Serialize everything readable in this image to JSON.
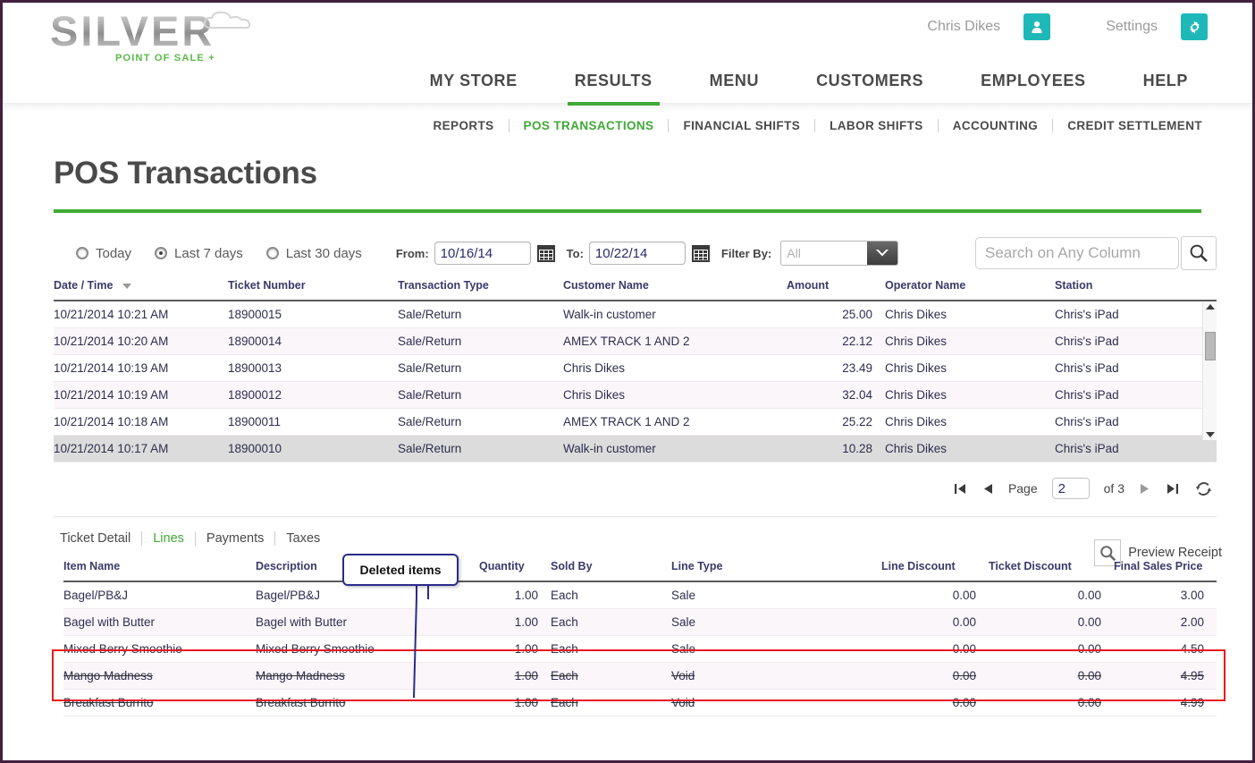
{
  "header": {
    "logo_text": "SILVER",
    "logo_sub": "POINT OF SALE +",
    "account_name": "Chris Dikes",
    "settings_label": "Settings",
    "user_icon": "user-icon",
    "gear_icon": "gear-icon",
    "accent_teal": "#1eb8b8"
  },
  "mainnav": {
    "items": [
      {
        "label": "MY STORE",
        "active": false
      },
      {
        "label": "RESULTS",
        "active": true
      },
      {
        "label": "MENU",
        "active": false
      },
      {
        "label": "CUSTOMERS",
        "active": false
      },
      {
        "label": "EMPLOYEES",
        "active": false
      },
      {
        "label": "HELP",
        "active": false
      }
    ],
    "active_color": "#3faa35"
  },
  "subnav": {
    "items": [
      {
        "label": "REPORTS",
        "active": false
      },
      {
        "label": "POS TRANSACTIONS",
        "active": true
      },
      {
        "label": "FINANCIAL SHIFTS",
        "active": false
      },
      {
        "label": "LABOR SHIFTS",
        "active": false
      },
      {
        "label": "ACCOUNTING",
        "active": false
      },
      {
        "label": "CREDIT SETTLEMENT",
        "active": false
      }
    ]
  },
  "page": {
    "title": "POS Transactions",
    "rule_color": "#3faa35"
  },
  "filters": {
    "radios": [
      {
        "label": "Today",
        "selected": false
      },
      {
        "label": "Last 7 days",
        "selected": true
      },
      {
        "label": "Last 30 days",
        "selected": false
      }
    ],
    "from_label": "From:",
    "from_value": "10/16/14",
    "to_label": "To:",
    "to_value": "10/22/14",
    "calendar_icon": "calendar-icon",
    "filter_by_label": "Filter By:",
    "filter_by_value": "All",
    "search_placeholder": "Search on Any Column",
    "search_value": "",
    "search_icon": "search-icon"
  },
  "transactions": {
    "columns": [
      "Date / Time",
      "Ticket Number",
      "Transaction Type",
      "Customer Name",
      "Amount",
      "Operator Name",
      "Station"
    ],
    "sort_column": "Date / Time",
    "sort_direction": "desc",
    "rows": [
      {
        "datetime": "10/21/2014 10:21 AM",
        "ticket": "18900015",
        "type": "Sale/Return",
        "customer": "Walk-in customer",
        "amount": "25.00",
        "operator": "Chris Dikes",
        "station": "Chris's iPad",
        "selected": false
      },
      {
        "datetime": "10/21/2014 10:20 AM",
        "ticket": "18900014",
        "type": "Sale/Return",
        "customer": "AMEX TRACK 1 AND 2",
        "amount": "22.12",
        "operator": "Chris Dikes",
        "station": "Chris's iPad",
        "selected": false
      },
      {
        "datetime": "10/21/2014 10:19 AM",
        "ticket": "18900013",
        "type": "Sale/Return",
        "customer": "Chris Dikes",
        "amount": "23.49",
        "operator": "Chris Dikes",
        "station": "Chris's iPad",
        "selected": false
      },
      {
        "datetime": "10/21/2014 10:19 AM",
        "ticket": "18900012",
        "type": "Sale/Return",
        "customer": "Chris Dikes",
        "amount": "32.04",
        "operator": "Chris Dikes",
        "station": "Chris's iPad",
        "selected": false
      },
      {
        "datetime": "10/21/2014 10:18 AM",
        "ticket": "18900011",
        "type": "Sale/Return",
        "customer": "AMEX TRACK 1 AND 2",
        "amount": "25.22",
        "operator": "Chris Dikes",
        "station": "Chris's iPad",
        "selected": false
      },
      {
        "datetime": "10/21/2014 10:17 AM",
        "ticket": "18900010",
        "type": "Sale/Return",
        "customer": "Walk-in customer",
        "amount": "10.28",
        "operator": "Chris Dikes",
        "station": "Chris's iPad",
        "selected": true
      }
    ]
  },
  "pager": {
    "first_icon": "first-page-icon",
    "prev_icon": "previous-page-icon",
    "page_label": "Page",
    "page_value": "2",
    "of_label": "of 3",
    "next_icon": "next-page-icon",
    "last_icon": "last-page-icon",
    "refresh_icon": "refresh-icon"
  },
  "detail": {
    "tabs": [
      {
        "label": "Ticket Detail",
        "active": false
      },
      {
        "label": "Lines",
        "active": true
      },
      {
        "label": "Payments",
        "active": false
      },
      {
        "label": "Taxes",
        "active": false
      }
    ],
    "preview_label": "Preview Receipt",
    "preview_icon": "magnifier-icon",
    "callout_label": "Deleted items",
    "callout_color": "#2b2b8c",
    "highlight_color": "#e81b17",
    "columns": [
      "Item Name",
      "Description",
      "Quantity",
      "Sold By",
      "Line Type",
      "Line Discount",
      "Ticket Discount",
      "Final Sales Price"
    ],
    "rows": [
      {
        "item": "Bagel/PB&J",
        "description": "Bagel/PB&J",
        "quantity": "1.00",
        "sold_by": "Each",
        "line_type": "Sale",
        "line_discount": "0.00",
        "ticket_discount": "0.00",
        "final_price": "3.00",
        "voided": false
      },
      {
        "item": "Bagel with Butter",
        "description": "Bagel with Butter",
        "quantity": "1.00",
        "sold_by": "Each",
        "line_type": "Sale",
        "line_discount": "0.00",
        "ticket_discount": "0.00",
        "final_price": "2.00",
        "voided": false
      },
      {
        "item": "Mixed Berry Smoothie",
        "description": "Mixed Berry Smoothie",
        "quantity": "1.00",
        "sold_by": "Each",
        "line_type": "Sale",
        "line_discount": "0.00",
        "ticket_discount": "0.00",
        "final_price": "4.50",
        "voided": false
      },
      {
        "item": "Mango Madness",
        "description": "Mango Madness",
        "quantity": "1.00",
        "sold_by": "Each",
        "line_type": "Void",
        "line_discount": "0.00",
        "ticket_discount": "0.00",
        "final_price": "4.95",
        "voided": true
      },
      {
        "item": "Breakfast Burrito",
        "description": "Breakfast Burrito",
        "quantity": "1.00",
        "sold_by": "Each",
        "line_type": "Void",
        "line_discount": "0.00",
        "ticket_discount": "0.00",
        "final_price": "4.99",
        "voided": true
      }
    ]
  }
}
